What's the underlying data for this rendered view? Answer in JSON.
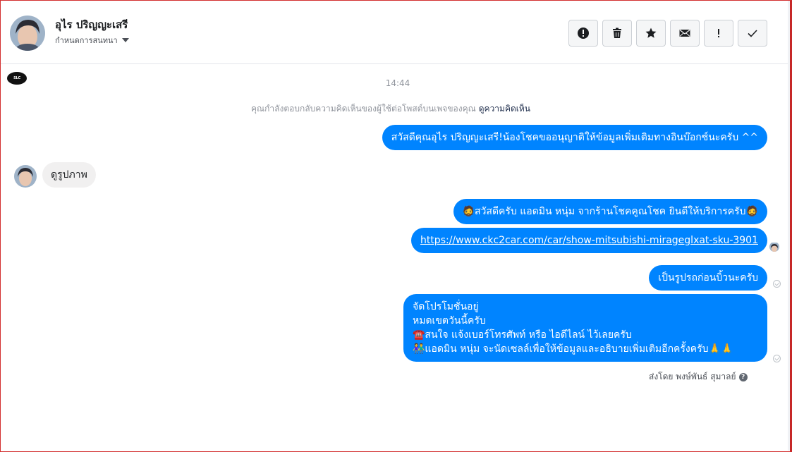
{
  "header": {
    "contact_name": "อุไร ปริญญะเสรี",
    "assign_label": "กำหนดการสนทนา",
    "toolbar": [
      {
        "name": "report-spam-button",
        "icon": "exclamation-circle-icon"
      },
      {
        "name": "delete-button",
        "icon": "trash-icon"
      },
      {
        "name": "star-button",
        "icon": "star-icon"
      },
      {
        "name": "mark-unread-button",
        "icon": "envelope-icon"
      },
      {
        "name": "mark-important-button",
        "icon": "exclamation-icon"
      },
      {
        "name": "mark-done-button",
        "icon": "checkmark-icon"
      }
    ]
  },
  "conversation": {
    "timestamp": "14:44",
    "notice_text": "คุณกำลังตอบกลับความคิดเห็นของผู้ใช้ต่อโพสต์บนเพจของคุณ",
    "notice_link": "ดูความคิดเห็น",
    "messages": {
      "m1": "สวัสดีคุณอุไร ปริญญะเสรี!น้องโชคขออนุญาติให้ข้อมูลเพิ่มเติมทางอินบ๊อกซ์นะครับ ^^",
      "m2": "ดูรูปภาพ",
      "m3": "🧔สวัสดีครับ แอดมิน หนุ่ม จากร้านโชคคูณโชค ยินดีให้บริการครับ🧔",
      "m4": "https://www.ckc2car.com/car/show-mitsubishi-mirageglxat-sku-3901",
      "m5": "เป็นรูปรถก่อนบิ้วนะครับ",
      "m6_lines": [
        "จัดโปรโมชั่นอยู่",
        "หมดเขตวันนี้ครับ",
        "☎️สนใจ แจ้งเบอร์โทรศัพท์ หรือ ไอดีไลน์  ไว้เลยครับ",
        "👫แอดมิน หนุ่ม จะนัดเซลล์เพื่อให้ข้อมูลและอธิบายเพิ่มเติมอีกครั้งครับ🙏🙏"
      ]
    },
    "sent_by": "ส่งโดย พงษ์พันธ์ สุมาลย์",
    "page_logo_text": "SLC"
  },
  "colors": {
    "bubble_out": "#0084ff",
    "bubble_in": "#f1f0f0",
    "text_muted": "#90949c"
  }
}
